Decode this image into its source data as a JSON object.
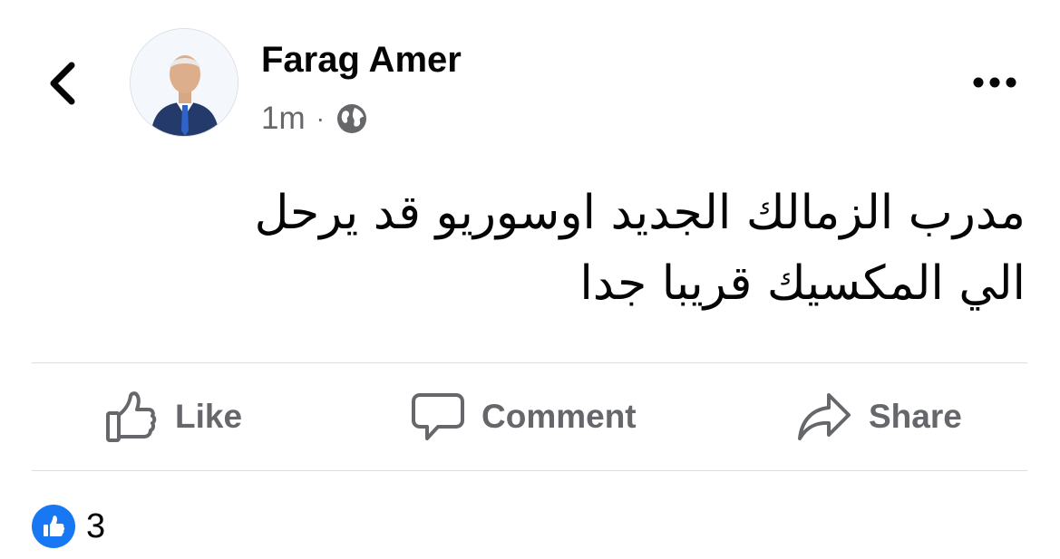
{
  "post": {
    "author_name": "Farag Amer",
    "timestamp": "1m",
    "separator": "·",
    "audience_icon": "globe-icon",
    "text_line_1": "مدرب الزمالك الجديد اوسوريو قد يرحل",
    "text_line_2": "الي المكسيك قريبا جدا"
  },
  "actions": {
    "like_label": "Like",
    "comment_label": "Comment",
    "share_label": "Share"
  },
  "reactions": {
    "count": "3",
    "icon": "thumbs-up-icon"
  },
  "colors": {
    "text_primary": "#050505",
    "text_secondary": "#65676b",
    "divider": "#dadde1",
    "like_blue": "#1877f2"
  }
}
